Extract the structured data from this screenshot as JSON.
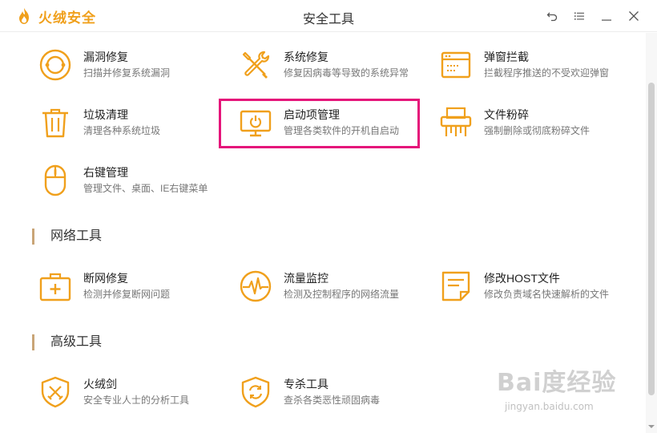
{
  "app": {
    "brand_name": "火绒安全",
    "window_title": "安全工具",
    "accent_color": "#f0a01c"
  },
  "window_controls": [
    {
      "icon": "back-icon"
    },
    {
      "icon": "menu-icon"
    },
    {
      "icon": "minimize-icon"
    },
    {
      "icon": "close-icon"
    }
  ],
  "system_tools": [
    {
      "name": "漏洞修复",
      "desc": "扫描并修复系统漏洞",
      "icon": "vulnerability-repair-icon"
    },
    {
      "name": "系统修复",
      "desc": "修复因病毒等导致的系统异常",
      "icon": "tools-wrench-icon"
    },
    {
      "name": "弹窗拦截",
      "desc": "拦截程序推送的不受欢迎弹窗",
      "icon": "popup-window-icon"
    },
    {
      "name": "垃圾清理",
      "desc": "清理各种系统垃圾",
      "icon": "trash-icon"
    },
    {
      "name": "启动项管理",
      "desc": "管理各类软件的开机自启动",
      "icon": "monitor-startup-icon"
    },
    {
      "name": "文件粉碎",
      "desc": "强制删除或彻底粉碎文件",
      "icon": "shredder-icon"
    },
    {
      "name": "右键管理",
      "desc": "管理文件、桌面、IE右键菜单",
      "icon": "mouse-icon"
    }
  ],
  "network_section": {
    "title": "网络工具"
  },
  "network_tools": [
    {
      "name": "断网修复",
      "desc": "检测并修复断网问题",
      "icon": "first-aid-kit-icon"
    },
    {
      "name": "流量监控",
      "desc": "检测及控制程序的网络流量",
      "icon": "traffic-pulse-icon"
    },
    {
      "name": "修改HOST文件",
      "desc": "修改负责域名快速解析的文件",
      "icon": "document-edit-icon"
    }
  ],
  "advanced_section": {
    "title": "高级工具"
  },
  "advanced_tools": [
    {
      "name": "火绒剑",
      "desc": "安全专业人士的分析工具",
      "icon": "shield-swords-icon"
    },
    {
      "name": "专杀工具",
      "desc": "查杀各类恶性顽固病毒",
      "icon": "shield-refresh-icon"
    }
  ],
  "watermark": {
    "main": "Bai度经验",
    "sub": "jingyan.baidu.com"
  }
}
